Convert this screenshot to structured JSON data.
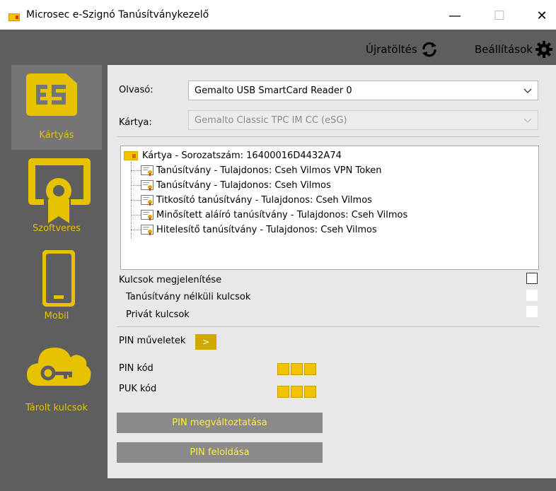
{
  "window": {
    "title": "Microsec e-Szignó Tanúsítványkezelő",
    "minimize": "—",
    "maximize": "☐",
    "close": "✕"
  },
  "toolbar": {
    "reload_label": "Újratöltés",
    "settings_label": "Beállítások"
  },
  "sidebar": {
    "items": [
      {
        "label": "Kártyás",
        "icon": "sim-card-icon",
        "active": true
      },
      {
        "label": "Szoftveres",
        "icon": "certificate-badge-icon",
        "active": false
      },
      {
        "label": "Mobil",
        "icon": "mobile-phone-icon",
        "active": false
      },
      {
        "label": "Tárolt kulcsok",
        "icon": "cloud-key-icon",
        "active": false
      }
    ]
  },
  "form": {
    "reader_label": "Olvasó:",
    "reader_value": "Gemalto USB SmartCard Reader 0",
    "card_label": "Kártya:",
    "card_value": "Gemalto Classic TPC IM CC (eSG)"
  },
  "tree": {
    "root": "Kártya - Sorozatszám: 16400016D4432A74",
    "items": [
      "Tanúsítvány - Tulajdonos: Cseh Vilmos VPN Token",
      "Tanúsítvány - Tulajdonos: Cseh Vilmos",
      "Titkosító tanúsítvány - Tulajdonos: Cseh Vilmos",
      "Minősített aláíró tanúsítvány - Tulajdonos: Cseh Vilmos",
      "Hitelesítő tanúsítvány - Tulajdonos: Cseh Vilmos"
    ]
  },
  "options": {
    "show_keys": "Kulcsok megjelenítése",
    "keys_without_cert": "Tanúsítvány nélküli kulcsok",
    "private_keys": "Privát kulcsok"
  },
  "pin": {
    "operations_label": "PIN műveletek",
    "toggle": ">",
    "pin_code_label": "PIN kód",
    "puk_code_label": "PUK kód",
    "change_button": "PIN megváltoztatása",
    "unblock_button": "PIN feloldása"
  },
  "colors": {
    "accent_yellow": "#e6c200",
    "background_dark": "#5e5e5e",
    "panel_light": "#e8e8e8",
    "button_gray": "#8a8a8a"
  }
}
